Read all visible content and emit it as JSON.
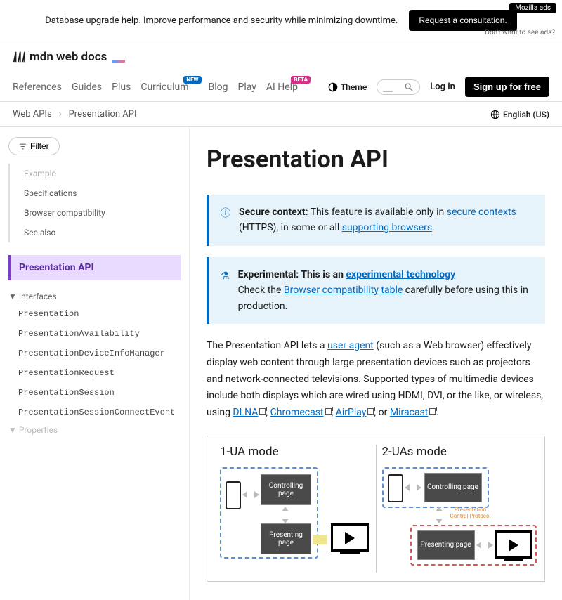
{
  "ad": {
    "label": "Mozilla ads",
    "text": "Database upgrade help. Improve performance and security while minimizing downtime.",
    "button": "Request a consultation.",
    "sub": "Don't want to see ads?"
  },
  "logo": "mdn web docs",
  "nav": {
    "references": "References",
    "guides": "Guides",
    "plus": "Plus",
    "curriculum": "Curriculum",
    "curriculum_badge": "NEW",
    "blog": "Blog",
    "play": "Play",
    "ai_help": "AI Help",
    "ai_help_badge": "BETA",
    "theme": "Theme",
    "search_placeholder": "__",
    "login": "Log in",
    "signup": "Sign up for free"
  },
  "breadcrumb": {
    "root": "Web APIs",
    "page": "Presentation API",
    "lang": "English (US)"
  },
  "sidebar": {
    "filter": "Filter",
    "toc": [
      "Example",
      "Specifications",
      "Browser compatibility",
      "See also"
    ],
    "section": "Presentation API",
    "group_interfaces": "Interfaces",
    "interfaces": [
      "Presentation",
      "PresentationAvailability",
      "PresentationDeviceInfoManager",
      "PresentationRequest",
      "PresentationSession",
      "PresentationSessionConnectEvent"
    ],
    "group_properties": "Properties"
  },
  "title": "Presentation API",
  "note_secure": {
    "lead": "Secure context:",
    "text": " This feature is available only in ",
    "link1": "secure contexts",
    "text2": " (HTTPS), in some or all ",
    "link2": "supporting browsers",
    "tail": "."
  },
  "note_exp": {
    "lead": "Experimental: This is an ",
    "link1": "experimental technology",
    "text2": "Check the ",
    "link2": "Browser compatibility table",
    "tail": " carefully before using this in production."
  },
  "intro": {
    "p1a": "The Presentation API lets a ",
    "ua": "user agent",
    "p1b": " (such as a Web browser) effectively display web content through large presentation devices such as projectors and network-connected televisions. Supported types of multimedia devices include both displays which are wired using HDMI, DVI, or the like, or wireless, using ",
    "dlna": "DLNA",
    "chromecast": "Chromecast",
    "airplay": "AirPlay",
    "or": ", or ",
    "miracast": "Miracast",
    "end": "."
  },
  "diagram": {
    "mode1": "1-UA mode",
    "mode2": "2-UAs mode",
    "ctrl": "Controlling page",
    "present": "Presenting page",
    "pcp": "Presentation Control Protocol"
  }
}
